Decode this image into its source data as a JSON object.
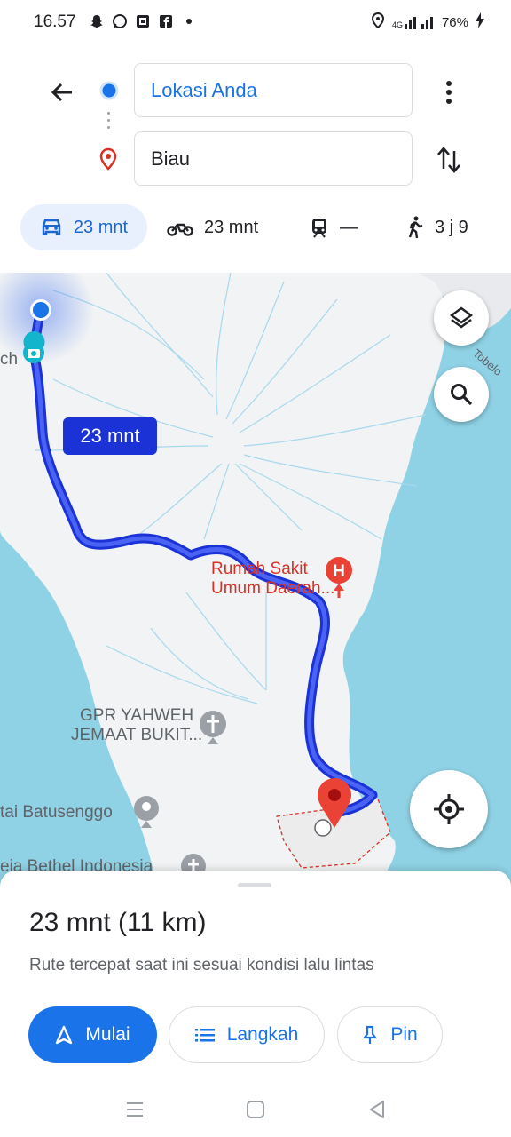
{
  "status_bar": {
    "time": "16.57",
    "notification_icons": [
      "snapchat-icon",
      "whatsapp-icon",
      "gallery-icon",
      "facebook-icon",
      "dot-icon"
    ],
    "network": "4G",
    "battery": "76%"
  },
  "directions": {
    "origin": "Lokasi Anda",
    "destination": "Biau"
  },
  "modes": {
    "car": "23 mnt",
    "motorcycle": "23 mnt",
    "transit": "—",
    "walk": "3 j 9"
  },
  "map": {
    "route_time": "23 mnt",
    "labels": {
      "hospital": "Rumah Sakit\nUmum Daerah...",
      "church": "GPR YAHWEH\nJEMAAT BUKIT...",
      "beach": "tai Batusenggo",
      "church2": "eja Bethel Indonesia",
      "road": "Tobelo",
      "edge": "ch"
    }
  },
  "route": {
    "summary": "23 mnt (11 km)",
    "description": "Rute tercepat saat ini sesuai kondisi lalu lintas"
  },
  "actions": {
    "start": "Mulai",
    "steps": "Langkah",
    "pin": "Pin"
  },
  "colors": {
    "accent": "#1a73e8",
    "route": "#1b32d6",
    "water": "#8fd2e5",
    "land": "#f1f3f4"
  }
}
